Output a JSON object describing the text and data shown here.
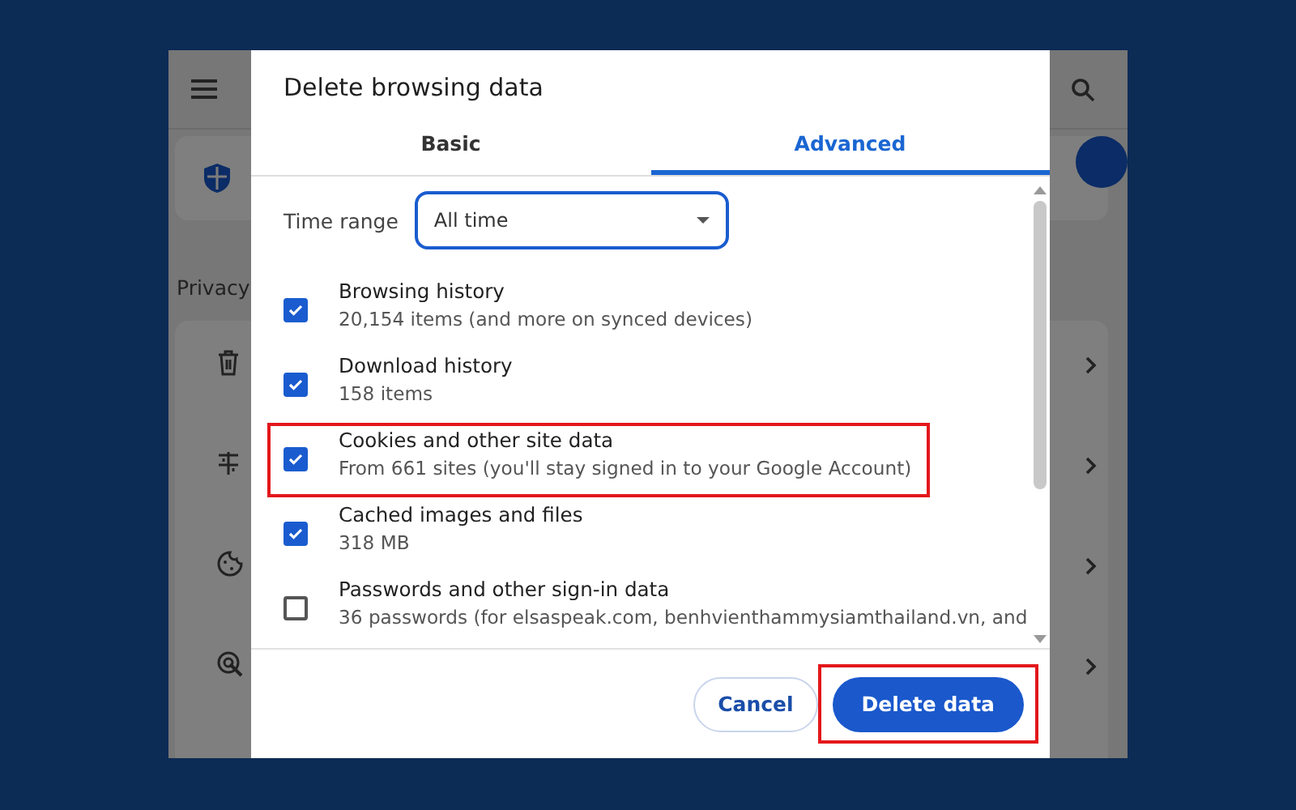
{
  "background_page": {
    "section_heading": "Privacy"
  },
  "dialog": {
    "title": "Delete browsing data",
    "tabs": [
      {
        "label": "Basic",
        "selected": false
      },
      {
        "label": "Advanced",
        "selected": true
      }
    ],
    "time_range": {
      "label": "Time range",
      "value": "All time"
    },
    "items": [
      {
        "title": "Browsing history",
        "detail": "20,154 items (and more on synced devices)",
        "checked": true,
        "highlighted": false
      },
      {
        "title": "Download history",
        "detail": "158 items",
        "checked": true,
        "highlighted": false
      },
      {
        "title": "Cookies and other site data",
        "detail": "From 661 sites (you'll stay signed in to your Google Account)",
        "checked": true,
        "highlighted": true
      },
      {
        "title": "Cached images and files",
        "detail": "318 MB",
        "checked": true,
        "highlighted": false
      },
      {
        "title": "Passwords and other sign-in data",
        "detail": "36 passwords (for elsaspeak.com, benhvienthammysiamthailand.vn, and",
        "checked": false,
        "highlighted": false
      }
    ],
    "buttons": [
      {
        "label": "Cancel",
        "kind": "secondary",
        "highlighted": false
      },
      {
        "label": "Delete data",
        "kind": "primary",
        "highlighted": true
      }
    ]
  }
}
